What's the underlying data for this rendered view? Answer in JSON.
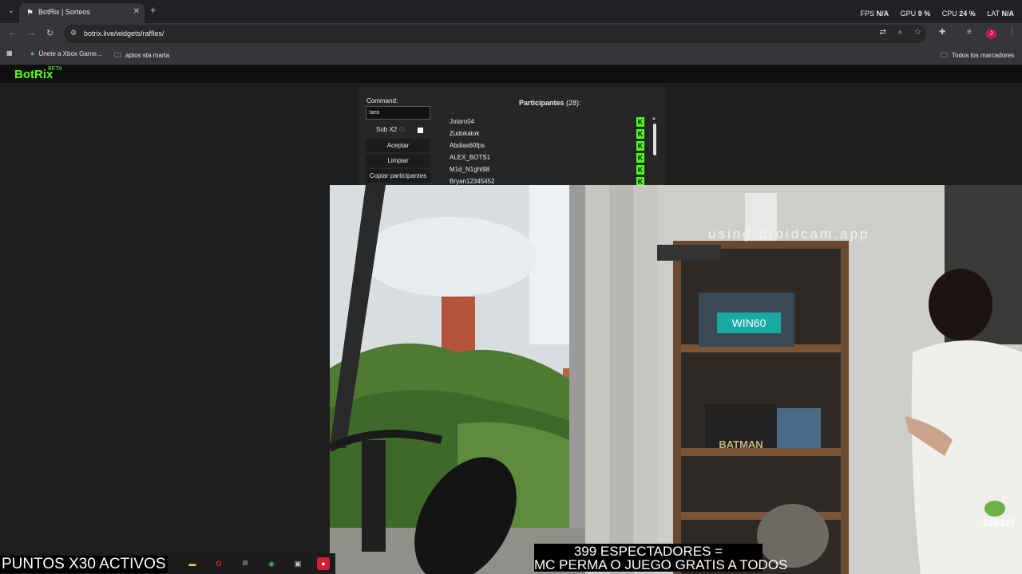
{
  "browser": {
    "tab_title": "BotRix | Sorteos",
    "url": "botrix.live/widgets/raffles/",
    "bookmarks": [
      "Únete a Xbox Game...",
      "aptos sta marta"
    ],
    "all_bookmarks": "Todos los marcadores",
    "avatar_initial": "J"
  },
  "overlay_stats": {
    "fps_label": "FPS",
    "fps_value": "N/A",
    "gpu_label": "GPU",
    "gpu_value": "9 %",
    "cpu_label": "CPU",
    "cpu_value": "24 %",
    "lat_label": "LAT",
    "lat_value": "N/A"
  },
  "app": {
    "brand": "BotRix",
    "beta": "BETA"
  },
  "raffle": {
    "command_label": "Command:",
    "command_value": "!aris",
    "sub_label": "Sub X2",
    "accept_button": "Aceptar",
    "clear_button": "Limpiar",
    "copy_button": "Copiar participantes",
    "participants_title": "Participantes",
    "participants_count": "(28):",
    "participants": [
      "Jotaro04",
      "Zudokatok",
      "Abdias60fps",
      "ALEX_BOTS1",
      "M1d_N1ght98",
      "Bryan12345452"
    ]
  },
  "stream": {
    "watermark": "using droidcam.app",
    "box_text": "WIN60",
    "batman_text": "BATMAN",
    "viewers_line1": "399 ESPECTADORES =",
    "viewers_line2": "MC PERMA O JUEGO GRATIS A TODOS",
    "points_banner": "PUNTOS X30 ACTIVOS",
    "counter": "220437"
  },
  "colors": {
    "kick_green": "#53fc18",
    "browser_bg": "#202124",
    "toolbar_bg": "#35363a"
  }
}
